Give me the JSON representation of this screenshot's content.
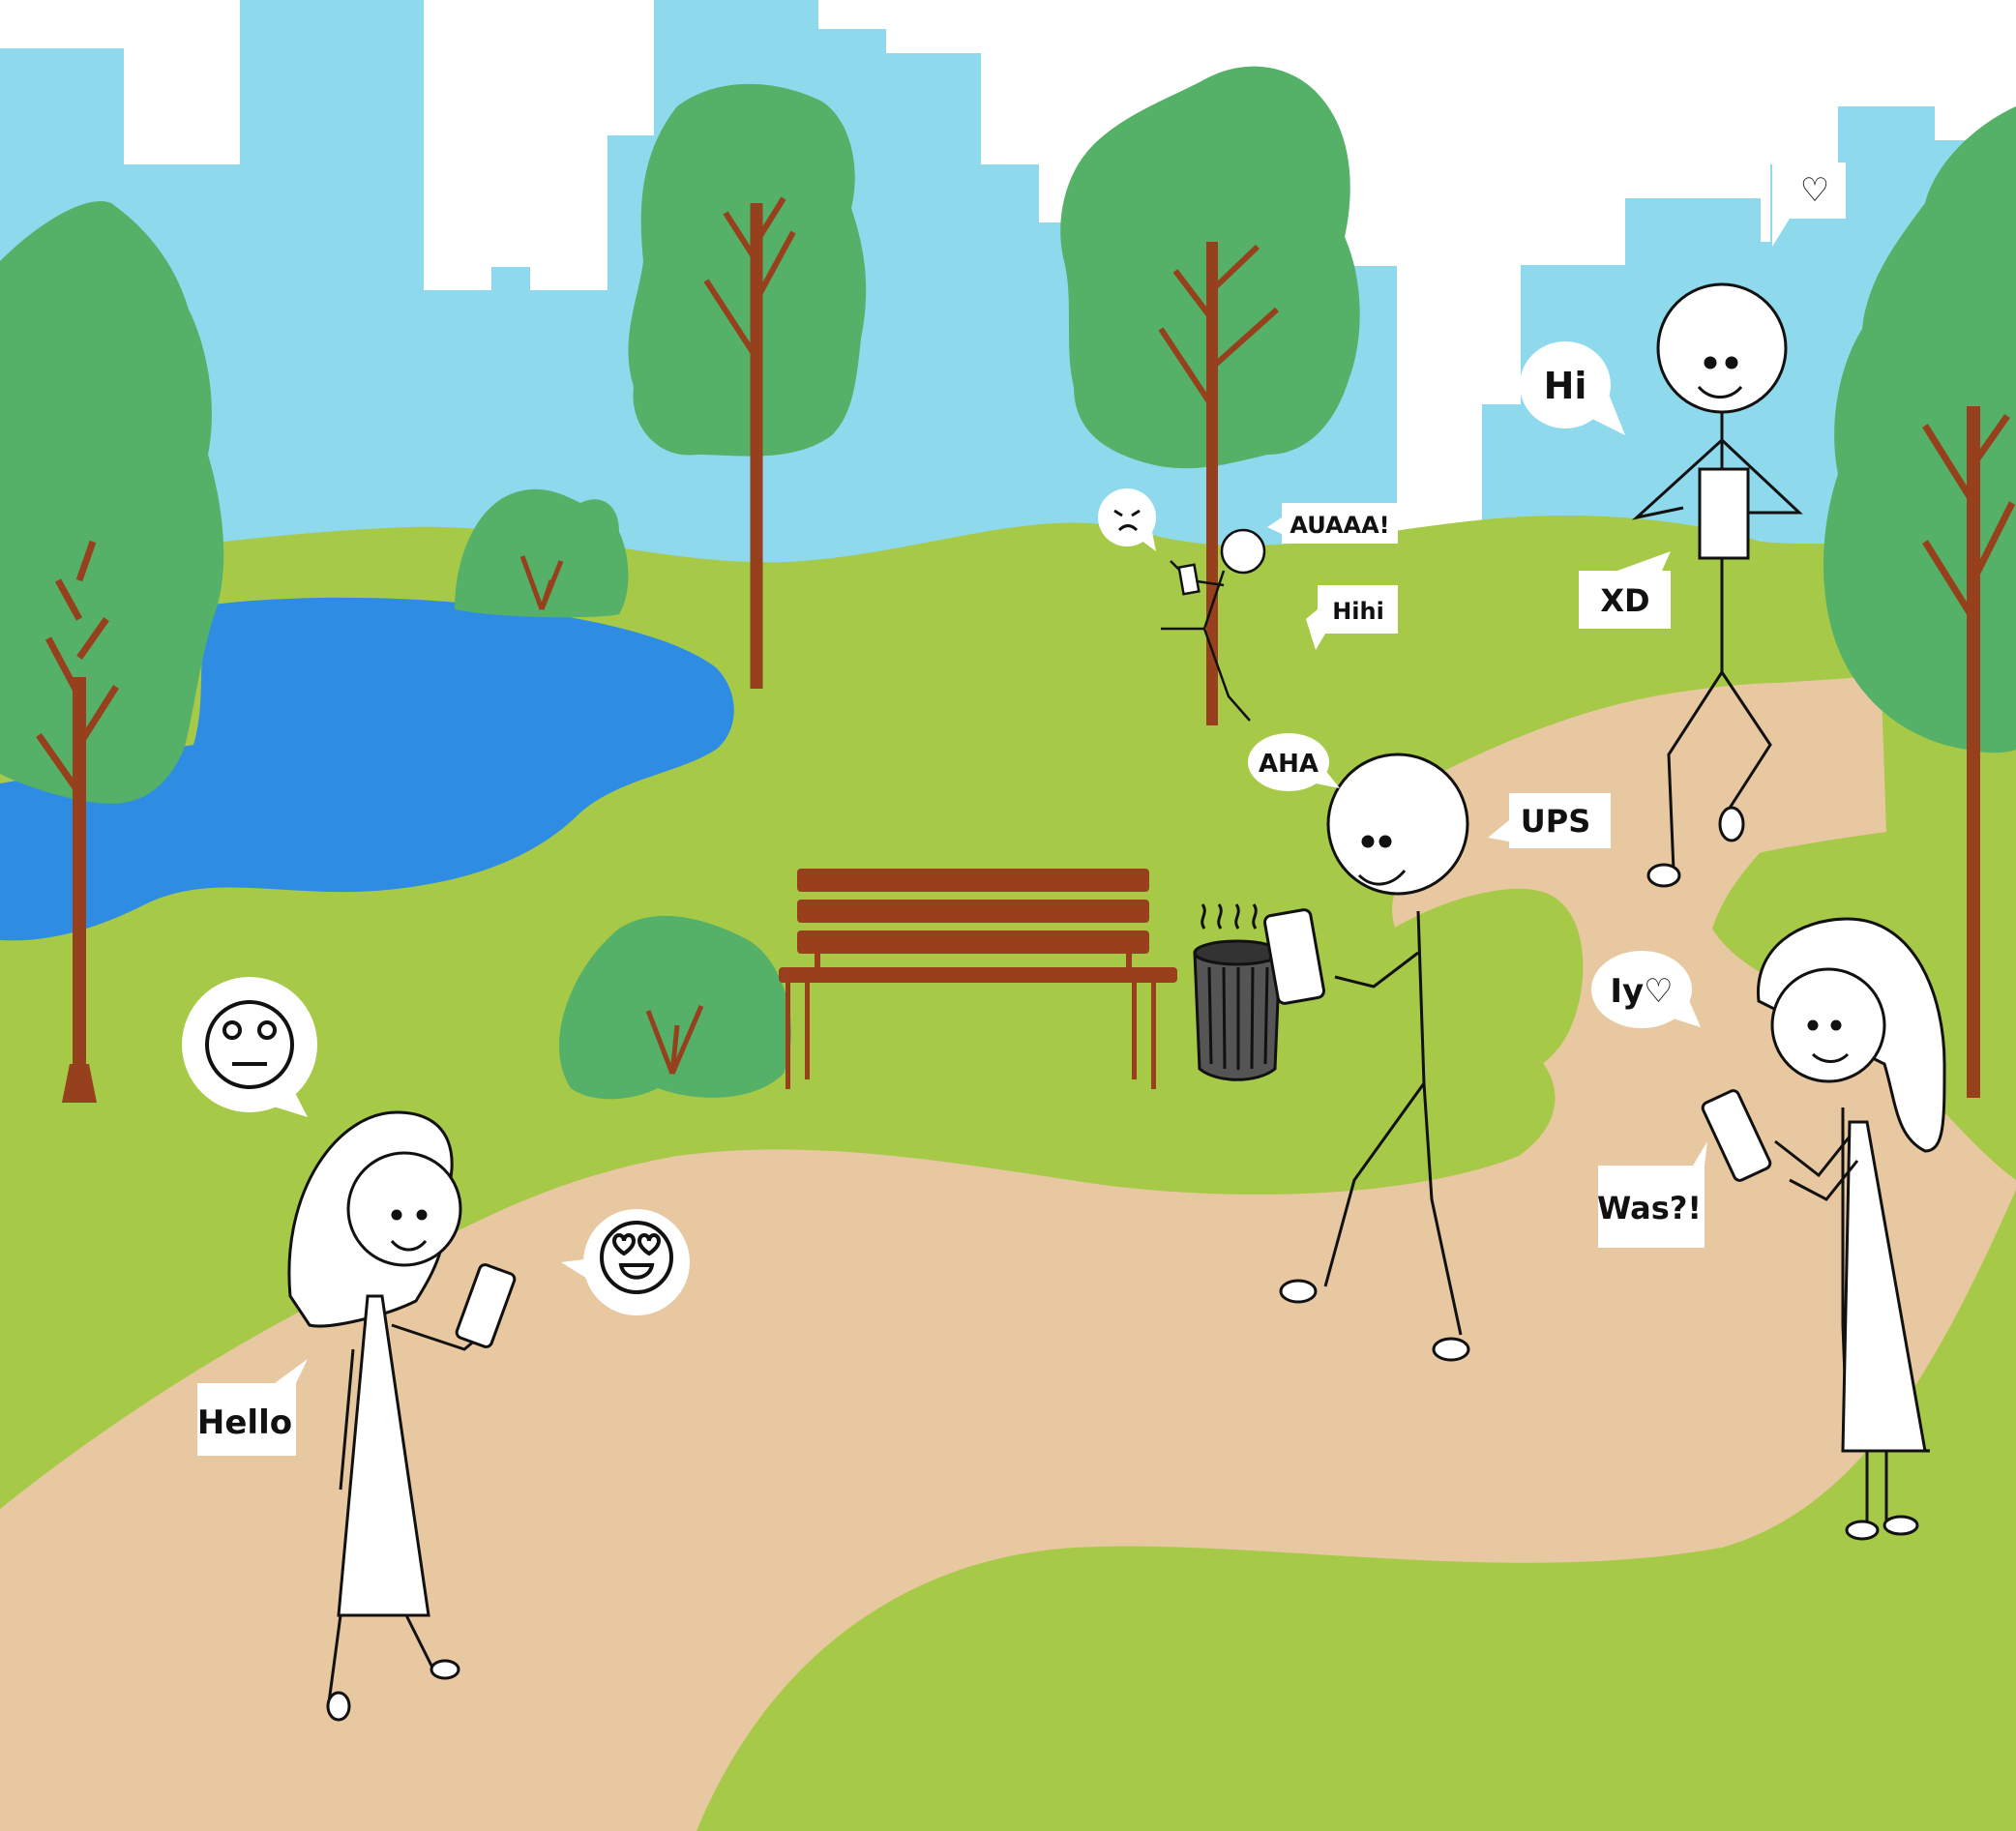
{
  "colors": {
    "sky": "#8fd9ec",
    "skyline": "#8fd9ec",
    "grass": "#a6c948",
    "grass_far": "#a6c948",
    "path": "#e8c8a0",
    "lake": "#2e8de3",
    "foliage": "#55b068",
    "trunk": "#96401d",
    "bench": "#9a3f1c",
    "bin": "#555555",
    "bubble": "#ffffff",
    "ink": "#111111"
  },
  "bubbles": {
    "hello": "Hello",
    "hi": "Hi",
    "xd": "XD",
    "auaaa": "AUAAA!",
    "hihi": "Hihi",
    "aha": "AHA",
    "ups": "UPS",
    "ily": "Iy♡",
    "was": "Was?!",
    "heart": "♡"
  },
  "emojis": {
    "neutral": "neutral-face-emoji",
    "heart_eyes": "heart-eyes-emoji",
    "angry": "angry-face-emoji"
  }
}
